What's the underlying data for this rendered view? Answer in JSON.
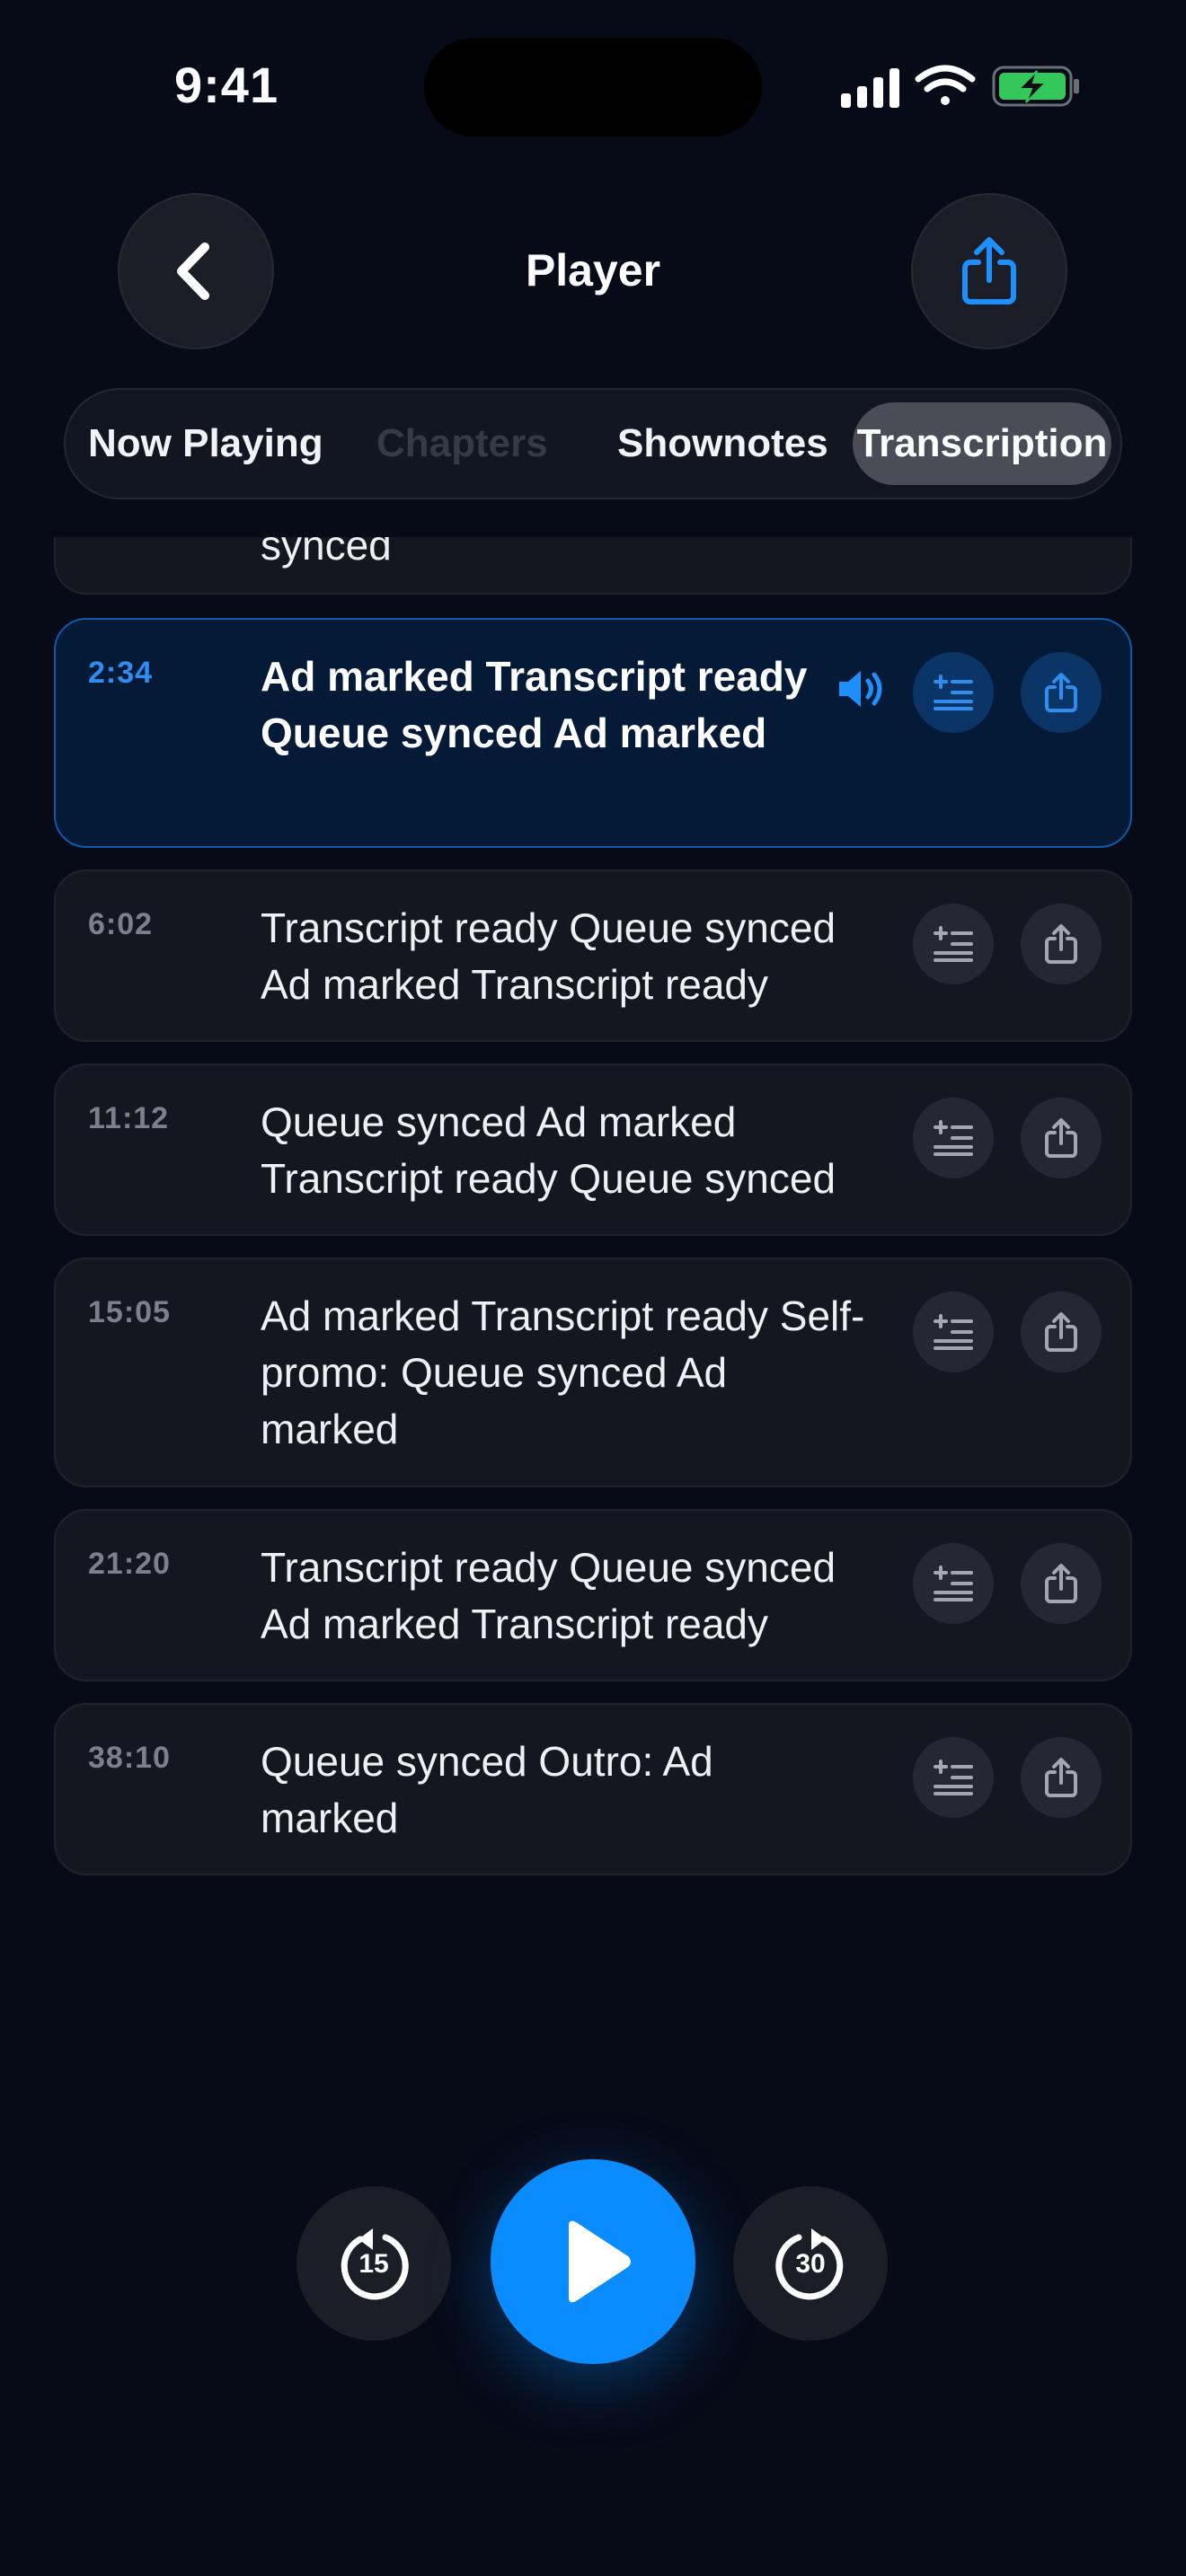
{
  "status_bar": {
    "time": "9:41"
  },
  "header": {
    "title": "Player",
    "back_icon": "chevron-left-icon",
    "share_icon": "share-icon"
  },
  "tabs": [
    {
      "label": "Now Playing",
      "state": "normal"
    },
    {
      "label": "Chapters",
      "state": "disabled"
    },
    {
      "label": "Shownotes",
      "state": "normal"
    },
    {
      "label": "Transcription",
      "state": "selected"
    }
  ],
  "transcript": {
    "partial_item_text": "synced",
    "items": [
      {
        "time": "2:34",
        "text": "Ad marked Transcript ready Queue synced Ad marked",
        "active": true
      },
      {
        "time": "6:02",
        "text": "Transcript ready Queue synced Ad marked Transcript ready",
        "active": false
      },
      {
        "time": "11:12",
        "text": "Queue synced Ad marked Transcript ready Queue synced",
        "active": false
      },
      {
        "time": "15:05",
        "text": "Ad marked Transcript ready Self-promo: Queue synced Ad marked",
        "active": false
      },
      {
        "time": "21:20",
        "text": "Transcript ready Queue synced Ad marked Transcript ready",
        "active": false
      },
      {
        "time": "38:10",
        "text": "Queue synced Outro: Ad marked",
        "active": false
      }
    ]
  },
  "playback": {
    "skip_back_label": "15",
    "skip_forward_label": "30",
    "play_icon": "play-icon"
  },
  "colors": {
    "accent": "#0A8CFF",
    "background": "#070B18",
    "card": "#14171F",
    "active_card": "#051A36",
    "battery": "#34C759"
  }
}
